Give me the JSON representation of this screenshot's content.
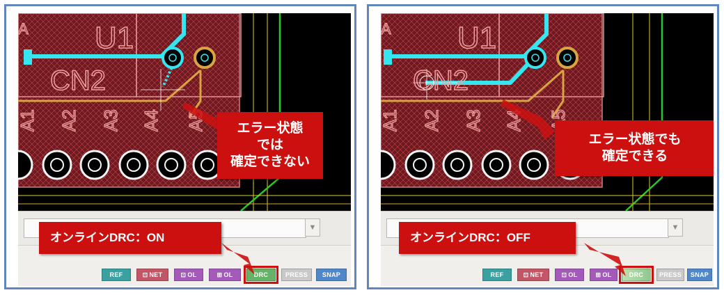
{
  "colors": {
    "frame": "#5f86bd",
    "board_bg": "#000000",
    "copper": "#7a1a22",
    "trace": "#35e6f0",
    "pad_ring": "#d9a441",
    "callout": "#cc1010",
    "btn_ref": "#3aa0a0",
    "btn_net": "#c25566",
    "btn_ol": "#a45ab8",
    "btn_drc_on": "#66b266",
    "btn_press": "#c9c9c9",
    "btn_snap": "#4f87c9"
  },
  "panels": [
    {
      "id": "left",
      "silkscreen": {
        "u1": "U1",
        "cn2": "CN2",
        "pins": [
          "A1",
          "A2",
          "A3",
          "A4",
          "A5"
        ]
      },
      "error_callout": "エラー状態\nでは\n確定できない",
      "drc_callout": "オンラインDRC：ON",
      "drc_state": "on",
      "scroll_icon": "chevron-down-icon",
      "status_buttons": {
        "ref": "REF",
        "net": "NET",
        "ol": "OL",
        "tol": "OL",
        "drc": "DRC",
        "press": "PRESS",
        "snap": "SNAP"
      }
    },
    {
      "id": "right",
      "silkscreen": {
        "u1": "U1",
        "cn2": "CN2",
        "pins": [
          "A1",
          "A2",
          "A3",
          "A4",
          "A5"
        ]
      },
      "error_callout": "エラー状態でも\n確定できる",
      "drc_callout": "オンラインDRC：OFF",
      "drc_state": "off",
      "scroll_icon": "chevron-down-icon",
      "status_buttons": {
        "ref": "REF",
        "net": "NET",
        "ol": "OL",
        "tol": "OL",
        "drc": "DRC",
        "press": "PRESS",
        "snap": "SNAP"
      }
    }
  ],
  "icons": {
    "net": "net-icon",
    "ol": "outline-icon",
    "tol": "text-outline-icon"
  }
}
